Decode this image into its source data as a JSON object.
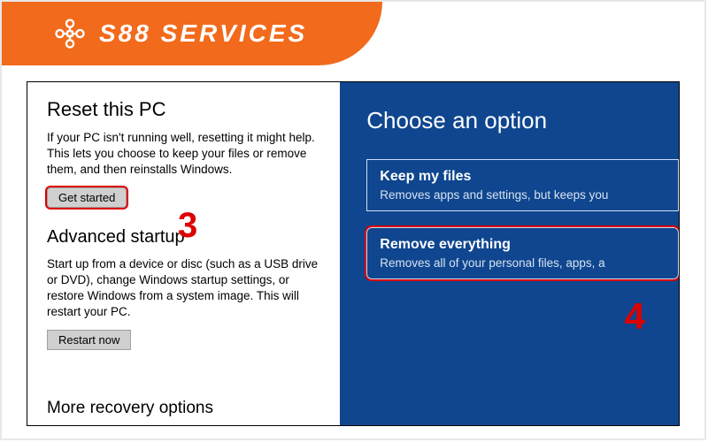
{
  "branding": {
    "text": "S88 SERVICES"
  },
  "left": {
    "reset": {
      "title": "Reset this PC",
      "desc": "If your PC isn't running well, resetting it might help. This lets you choose to keep your files or remove them, and then reinstalls Windows.",
      "button": "Get started"
    },
    "advanced": {
      "title": "Advanced startup",
      "desc": "Start up from a device or disc (such as a USB drive or DVD), change Windows startup settings, or restore Windows from a system image. This will restart your PC.",
      "button": "Restart now"
    },
    "more": "More recovery options"
  },
  "right": {
    "title": "Choose an option",
    "options": [
      {
        "title": "Keep my files",
        "desc": "Removes apps and settings, but keeps you"
      },
      {
        "title": "Remove everything",
        "desc": "Removes all of your personal files, apps, a"
      }
    ]
  },
  "annotations": {
    "step3": "3",
    "step4": "4"
  }
}
